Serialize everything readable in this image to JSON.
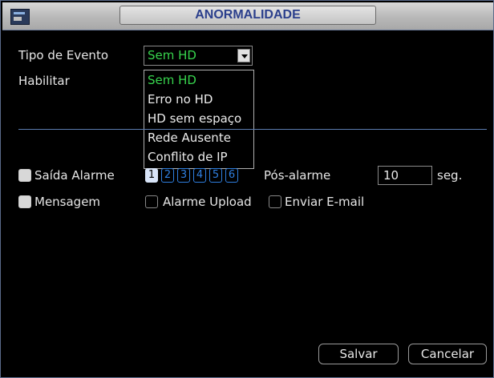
{
  "window": {
    "title": "ANORMALIDADE",
    "icon": "dvr-window-icon"
  },
  "form": {
    "event_type_label": "Tipo de Evento",
    "event_type_value": "Sem HD",
    "enable_label": "Habilitar",
    "event_type_options": [
      {
        "label": "Sem HD",
        "selected": true
      },
      {
        "label": "Erro no HD",
        "selected": false
      },
      {
        "label": "HD sem espaço",
        "selected": false
      },
      {
        "label": "Rede Ausente",
        "selected": false
      },
      {
        "label": "Conflito de IP",
        "selected": false
      }
    ],
    "alarm_output_label": "Saída Alarme",
    "alarm_output_checked": true,
    "channels": [
      "1",
      "2",
      "3",
      "4",
      "5",
      "6"
    ],
    "active_channel": "1",
    "post_alarm_label": "Pós-alarme",
    "post_alarm_value": "10",
    "post_alarm_unit": "seg.",
    "message_label": "Mensagem",
    "message_checked": true,
    "alarm_upload_label": "Alarme Upload",
    "alarm_upload_checked": false,
    "send_email_label": "Enviar E-mail",
    "send_email_checked": false
  },
  "buttons": {
    "save": "Salvar",
    "cancel": "Cancelar"
  },
  "colors": {
    "title_text": "#2b3f8c",
    "selected_option": "#37d44d",
    "channel_blue": "#2f7fe0"
  }
}
